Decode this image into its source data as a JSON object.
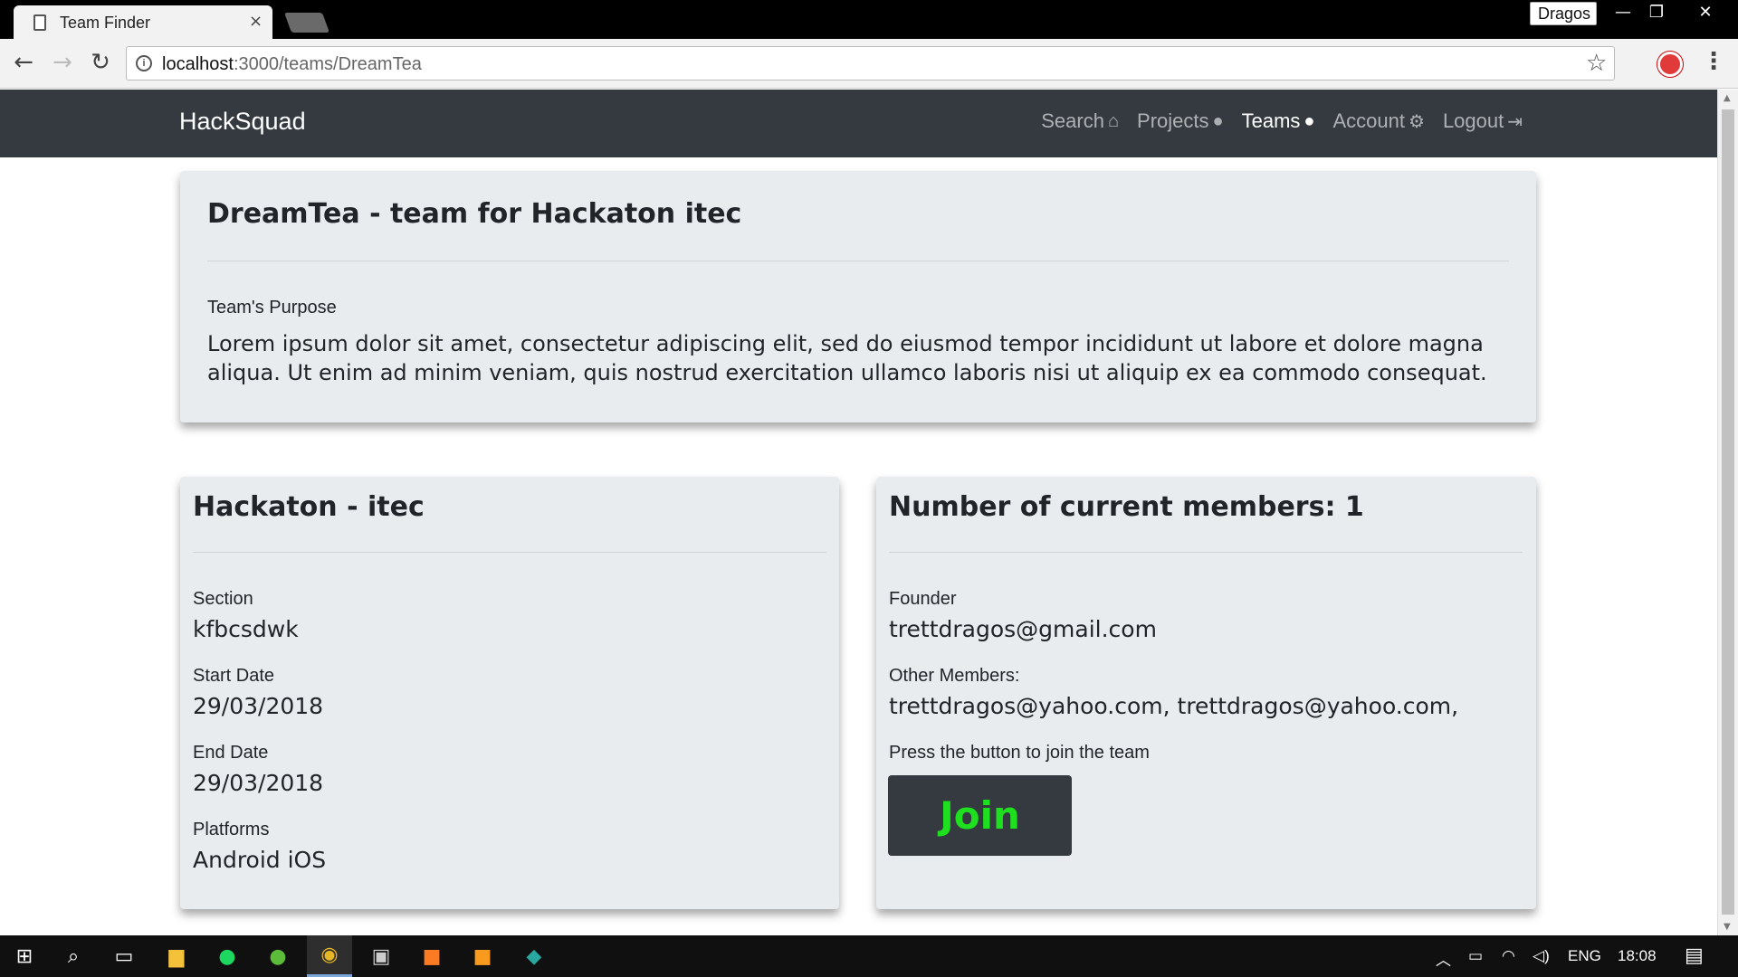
{
  "browser": {
    "tab_title": "Team Finder",
    "tab_close": "×",
    "profile_name": "Dragos",
    "window_controls": [
      "—",
      "❐",
      "✕"
    ],
    "url_host": "localhost",
    "url_rest": ":3000/teams/DreamTea"
  },
  "navbar": {
    "brand": "HackSquad",
    "links": [
      {
        "label": "Search",
        "icon": "home-icon",
        "glyph": "⌂",
        "active": false
      },
      {
        "label": "Projects",
        "icon": "user-icon",
        "glyph": "👤",
        "active": false
      },
      {
        "label": "Teams",
        "icon": "user-icon",
        "glyph": "👤",
        "active": true
      },
      {
        "label": "Account",
        "icon": "gears-icon",
        "glyph": "⚙",
        "active": false
      },
      {
        "label": "Logout",
        "icon": "sign-out-icon",
        "glyph": "⇥",
        "active": false
      }
    ]
  },
  "team_card": {
    "title": "DreamTea - team for Hackaton itec",
    "purpose_label": "Team's Purpose",
    "purpose_text": "Lorem ipsum dolor sit amet, consectetur adipiscing elit, sed do eiusmod tempor incididunt ut labore et dolore magna aliqua. Ut enim ad minim veniam, quis nostrud exercitation ullamco laboris nisi ut aliquip ex ea commodo consequat."
  },
  "hackaton_card": {
    "title": "Hackaton - itec",
    "section_label": "Section",
    "section_value": "kfbcsdwk",
    "start_label": "Start Date",
    "start_value": "29/03/2018",
    "end_label": "End Date",
    "end_value": "29/03/2018",
    "platforms_label": "Platforms",
    "platforms_value": "Android iOS"
  },
  "members_card": {
    "title": "Number of current members: 1",
    "founder_label": "Founder",
    "founder_value": "trettdragos@gmail.com",
    "others_label": "Other Members:",
    "others_value": "trettdragos@yahoo.com, trettdragos@yahoo.com,",
    "join_hint": "Press the button to join the team",
    "join_label": "Join",
    "join_color": "#1ee01e"
  },
  "taskbar": {
    "language": "ENG",
    "time": "18:08"
  }
}
